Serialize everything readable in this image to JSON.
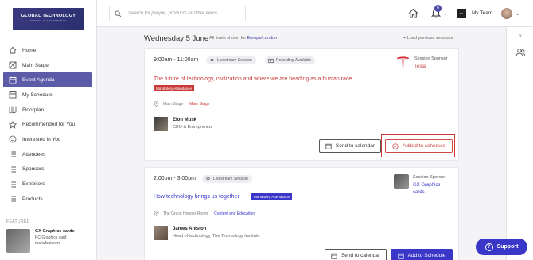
{
  "brand": {
    "name": "GLOBAL TECHNOLOGY",
    "subtitle": "SUMMIT & CONFERENCE"
  },
  "sidebar": {
    "items": [
      {
        "label": "Home",
        "icon": "home-icon"
      },
      {
        "label": "Main Stage",
        "icon": "stage-icon"
      },
      {
        "label": "Event Agenda",
        "icon": "agenda-icon",
        "active": true
      },
      {
        "label": "My Schedule",
        "icon": "schedule-icon"
      },
      {
        "label": "Floorplan",
        "icon": "floorplan-icon"
      },
      {
        "label": "Recommended for You",
        "icon": "star-icon"
      },
      {
        "label": "Interested in You",
        "icon": "smile-icon"
      },
      {
        "label": "Attendees",
        "icon": "list-icon"
      },
      {
        "label": "Sponsors",
        "icon": "list-icon"
      },
      {
        "label": "Exhibitors",
        "icon": "list-icon"
      },
      {
        "label": "Products",
        "icon": "list-icon"
      }
    ],
    "featured_label": "FEATURED",
    "featured": {
      "title": "GX Graphics cards",
      "subtitle": "PC Graphics card manufacturers"
    }
  },
  "topbar": {
    "search_placeholder": "Search for people, products or other items",
    "notification_count": "6",
    "team_name": "My Team",
    "team_logo_text": "MY TEAM"
  },
  "agenda": {
    "date": "Wednesday 5 June",
    "tz_prefix": "All times shown for",
    "tz_link": "Europe/London",
    "load_previous": "+ Load previous sessions"
  },
  "sessions": [
    {
      "time": "9:00am - 11:00am",
      "type_pill": "Livestream Session",
      "rec_pill": "Recording Available",
      "title": "The future of technology, civilization and where we are heading as a human race",
      "mandatory": "Mandatory Attendance",
      "location": "Main Stage",
      "location_tag": "Main Stage",
      "speaker_name": "Elon Musk",
      "speaker_role": "CEO & Entrepreneur",
      "sponsor_label": "Session Sponsor",
      "sponsor_name": "Tesla",
      "btn_calendar": "Send to calendar",
      "btn_schedule": "Added to schedule",
      "accent": "#c83a3a"
    },
    {
      "time": "2:00pm - 3:00pm",
      "type_pill": "Livestream Session",
      "title": "How technology brings us together",
      "mandatory": "Mandatory Attendance",
      "location": "The Grace Hooper Room",
      "location_tag": "Content and Education",
      "speaker_name": "James Aniston",
      "speaker_role": "Head of technology, The Technology Institute",
      "sponsor_label": "Session Sponsor",
      "sponsor_name": "GX Graphics cards",
      "btn_calendar": "Send to calendar",
      "btn_schedule": "Add to Schedule",
      "accent": "#3a36c8"
    }
  ],
  "support_label": "Support"
}
